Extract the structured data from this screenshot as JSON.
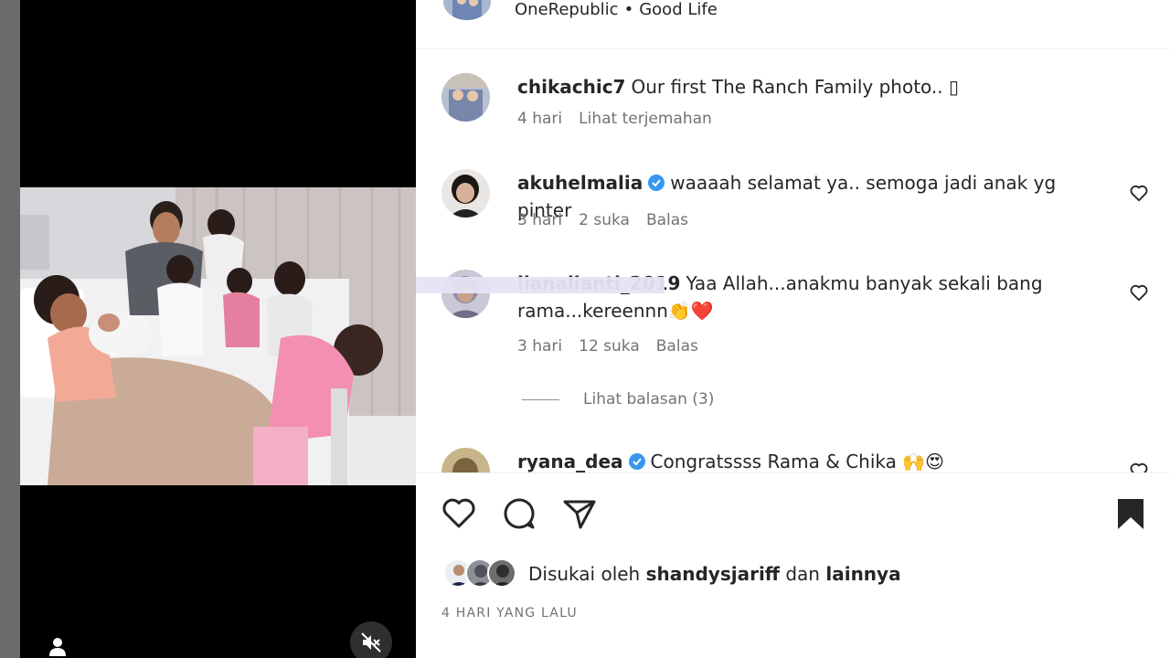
{
  "post": {
    "audio": {
      "artist": "OneRepublic",
      "separator": "•",
      "track": "Good Life"
    },
    "caption": {
      "username": "chikachic7",
      "text": "Our first The Ranch Family photo.. ▯",
      "time": "4 hari",
      "translate": "Lihat terjemahan"
    },
    "comments": [
      {
        "username": "akuhelmalia",
        "verified": true,
        "text": "waaaah selamat ya.. semoga jadi anak yg pinter",
        "time": "3 hari",
        "likes": "2 suka",
        "reply": "Balas"
      },
      {
        "username": "lianalianti_2019",
        "verified": false,
        "text": "Yaa Allah...anakmu banyak sekali bang rama...kereennn👏❤️",
        "time": "3 hari",
        "likes": "12 suka",
        "reply": "Balas",
        "view_replies": "Lihat balasan (3)"
      },
      {
        "username": "ryana_dea",
        "verified": true,
        "text": "Congratssss Rama & Chika 🙌😍"
      }
    ],
    "likes": {
      "prefix": "Disukai oleh",
      "user": "shandysjariff",
      "conjunction": "dan",
      "others": "lainnya"
    },
    "date": "4 HARI YANG LALU"
  },
  "icons": {
    "heart": "heart-icon",
    "comment": "comment-icon",
    "share": "share-icon",
    "save": "bookmark-icon",
    "tag": "user-tag-icon",
    "mute": "speaker-muted-icon",
    "verified": "verified-badge-icon"
  },
  "colors": {
    "verified": "#3897f0",
    "accent_text": "#262626",
    "muted_text": "#737373",
    "like_red": "#ed4956"
  }
}
